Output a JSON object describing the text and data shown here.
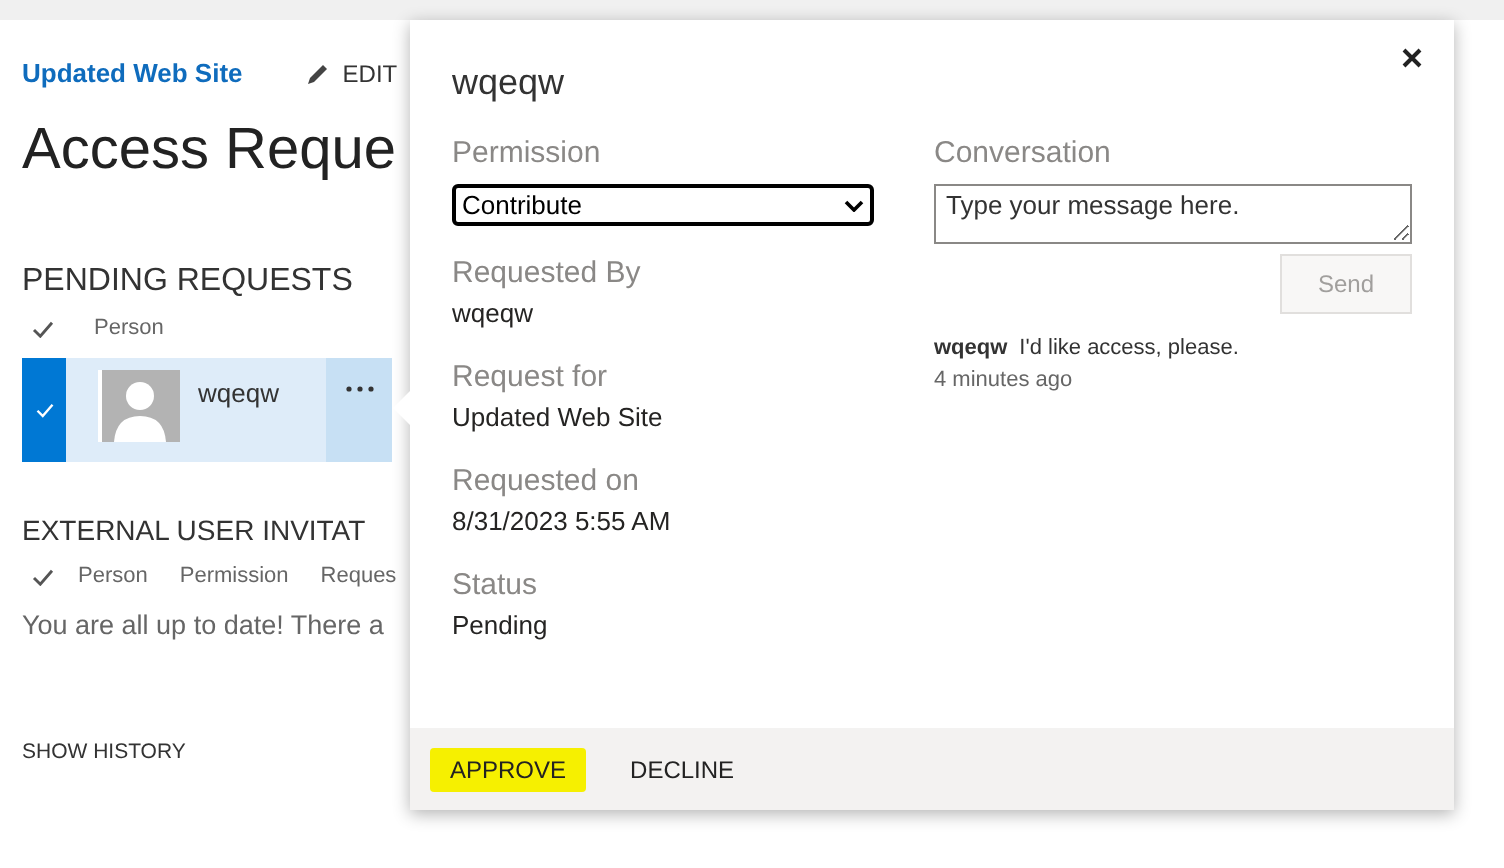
{
  "site_link": "Updated Web Site",
  "edit_label": "EDIT",
  "page_title": "Access Reque",
  "pending": {
    "heading": "PENDING REQUESTS",
    "columns": [
      "Person"
    ],
    "rows": [
      {
        "name": "wqeqw",
        "selected": true
      }
    ]
  },
  "external": {
    "heading": "EXTERNAL USER INVITAT",
    "columns": [
      "Person",
      "Permission",
      "Reques"
    ],
    "empty_message": "You are all up to date! There a"
  },
  "show_history": "SHOW HISTORY",
  "dialog": {
    "title": "wqeqw",
    "fields": [
      {
        "kind": "select",
        "label": "Permission",
        "value": "Contribute"
      },
      {
        "kind": "text",
        "label": "Requested By",
        "value": "wqeqw"
      },
      {
        "kind": "text",
        "label": "Request for",
        "value": "Updated Web Site"
      },
      {
        "kind": "text",
        "label": "Requested on",
        "value": "8/31/2023 5:55 AM"
      },
      {
        "kind": "text",
        "label": "Status",
        "value": "Pending"
      }
    ],
    "conversation": {
      "label": "Conversation",
      "placeholder": "Type your message here.",
      "send": "Send",
      "send_disabled": true,
      "messages": [
        {
          "author": "wqeqw",
          "text": "I'd like access, please.",
          "time": "4 minutes ago"
        }
      ]
    },
    "actions": [
      {
        "label": "APPROVE",
        "highlighted": true
      },
      {
        "label": "DECLINE",
        "highlighted": false
      }
    ]
  }
}
